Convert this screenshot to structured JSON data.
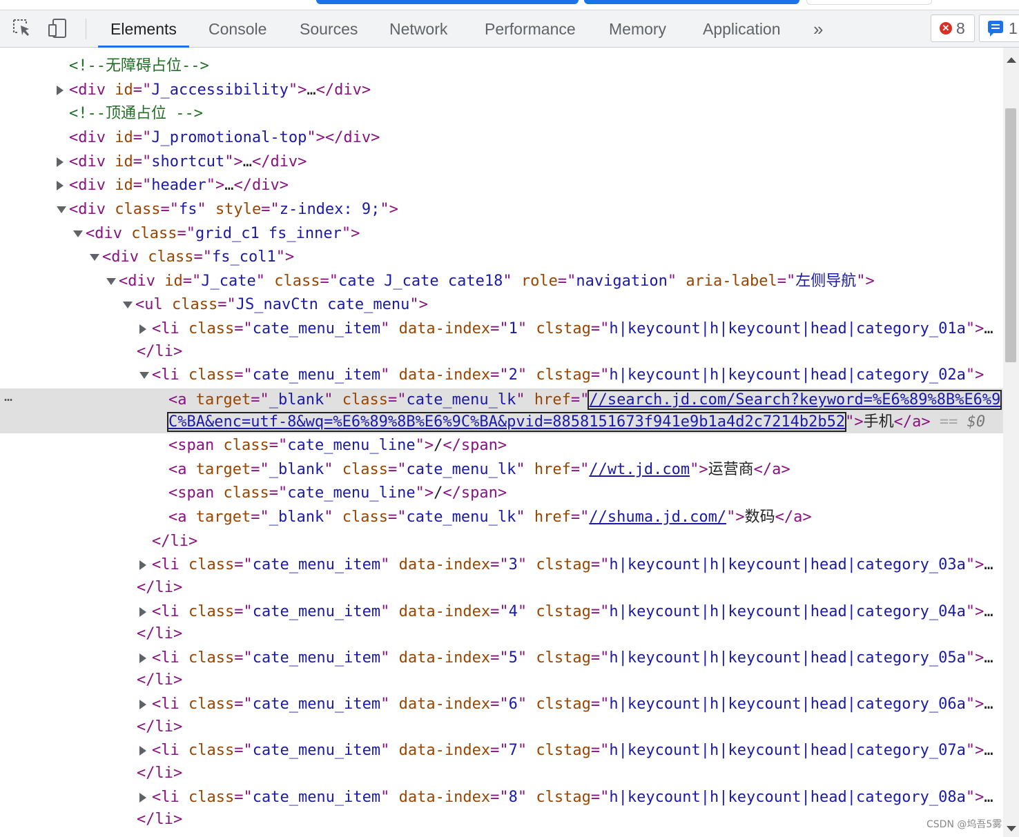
{
  "toolbar": {
    "tabs": [
      "Elements",
      "Console",
      "Sources",
      "Network",
      "Performance",
      "Memory",
      "Application"
    ],
    "more_label": "»",
    "error_count": "8",
    "message_count": "1"
  },
  "lines": [
    {
      "indent": 100,
      "tri": "none",
      "parts": [
        [
          "cm",
          "<!--无障碍占位-->"
        ]
      ]
    },
    {
      "indent": 100,
      "tri": "closed",
      "parts": [
        [
          "t",
          "<div "
        ],
        [
          "an",
          "id"
        ],
        [
          "t",
          "=\""
        ],
        [
          "av",
          "J_accessibility"
        ],
        [
          "t",
          "\">"
        ],
        [
          "tx",
          "…"
        ],
        [
          "t",
          "</div>"
        ]
      ]
    },
    {
      "indent": 100,
      "tri": "none",
      "parts": [
        [
          "cm",
          "<!--顶通占位 -->"
        ]
      ]
    },
    {
      "indent": 100,
      "tri": "none",
      "parts": [
        [
          "t",
          "<div "
        ],
        [
          "an",
          "id"
        ],
        [
          "t",
          "=\""
        ],
        [
          "av",
          "J_promotional-top"
        ],
        [
          "t",
          "\"></div>"
        ]
      ]
    },
    {
      "indent": 100,
      "tri": "closed",
      "parts": [
        [
          "t",
          "<div "
        ],
        [
          "an",
          "id"
        ],
        [
          "t",
          "=\""
        ],
        [
          "av",
          "shortcut"
        ],
        [
          "t",
          "\">"
        ],
        [
          "tx",
          "…"
        ],
        [
          "t",
          "</div>"
        ]
      ]
    },
    {
      "indent": 100,
      "tri": "closed",
      "parts": [
        [
          "t",
          "<div "
        ],
        [
          "an",
          "id"
        ],
        [
          "t",
          "=\""
        ],
        [
          "av",
          "header"
        ],
        [
          "t",
          "\">"
        ],
        [
          "tx",
          "…"
        ],
        [
          "t",
          "</div>"
        ]
      ]
    },
    {
      "indent": 100,
      "tri": "open",
      "parts": [
        [
          "t",
          "<div "
        ],
        [
          "an",
          "class"
        ],
        [
          "t",
          "=\""
        ],
        [
          "av",
          "fs"
        ],
        [
          "t",
          "\" "
        ],
        [
          "an",
          "style"
        ],
        [
          "t",
          "=\""
        ],
        [
          "av",
          "z-index: 9;"
        ],
        [
          "t",
          "\">"
        ]
      ]
    },
    {
      "indent": 124,
      "tri": "open",
      "parts": [
        [
          "t",
          "<div "
        ],
        [
          "an",
          "class"
        ],
        [
          "t",
          "=\""
        ],
        [
          "av",
          "grid_c1 fs_inner"
        ],
        [
          "t",
          "\">"
        ]
      ]
    },
    {
      "indent": 148,
      "tri": "open",
      "parts": [
        [
          "t",
          "<div "
        ],
        [
          "an",
          "class"
        ],
        [
          "t",
          "=\""
        ],
        [
          "av",
          "fs_col1"
        ],
        [
          "t",
          "\">"
        ]
      ]
    },
    {
      "indent": 172,
      "tri": "open",
      "parts": [
        [
          "t",
          "<div "
        ],
        [
          "an",
          "id"
        ],
        [
          "t",
          "=\""
        ],
        [
          "av",
          "J_cate"
        ],
        [
          "t",
          "\" "
        ],
        [
          "an",
          "class"
        ],
        [
          "t",
          "=\""
        ],
        [
          "av",
          "cate J_cate cate18"
        ],
        [
          "t",
          "\" "
        ],
        [
          "an",
          "role"
        ],
        [
          "t",
          "=\""
        ],
        [
          "av",
          "navigation"
        ],
        [
          "t",
          "\" "
        ],
        [
          "an",
          "aria-label"
        ],
        [
          "t",
          "=\""
        ],
        [
          "av",
          "左侧导航"
        ],
        [
          "t",
          "\">"
        ]
      ]
    },
    {
      "indent": 196,
      "tri": "open",
      "parts": [
        [
          "t",
          "<ul "
        ],
        [
          "an",
          "class"
        ],
        [
          "t",
          "=\""
        ],
        [
          "av",
          "JS_navCtn cate_menu"
        ],
        [
          "t",
          "\">"
        ]
      ]
    },
    {
      "indent": 220,
      "tri": "closed",
      "parts": [
        [
          "t",
          "<li "
        ],
        [
          "an",
          "class"
        ],
        [
          "t",
          "=\""
        ],
        [
          "av",
          "cate_menu_item"
        ],
        [
          "t",
          "\" "
        ],
        [
          "an",
          "data-index"
        ],
        [
          "t",
          "=\""
        ],
        [
          "av",
          "1"
        ],
        [
          "t",
          "\" "
        ],
        [
          "an",
          "clstag"
        ],
        [
          "t",
          "=\""
        ],
        [
          "av",
          "h|keycount|h|keycount|head|category_01a"
        ],
        [
          "t",
          "\">"
        ],
        [
          "tx",
          "…"
        ]
      ]
    },
    {
      "indent": 198,
      "tri": "none",
      "parts": [
        [
          "t",
          "</li>"
        ]
      ]
    },
    {
      "indent": 220,
      "tri": "open",
      "parts": [
        [
          "t",
          "<li "
        ],
        [
          "an",
          "class"
        ],
        [
          "t",
          "=\""
        ],
        [
          "av",
          "cate_menu_item"
        ],
        [
          "t",
          "\" "
        ],
        [
          "an",
          "data-index"
        ],
        [
          "t",
          "=\""
        ],
        [
          "av",
          "2"
        ],
        [
          "t",
          "\" "
        ],
        [
          "an",
          "clstag"
        ],
        [
          "t",
          "=\""
        ],
        [
          "av",
          "h|keycount|h|keycount|head|category_02a"
        ],
        [
          "t",
          "\">"
        ]
      ]
    },
    {
      "indent": 244,
      "tri": "none",
      "parts": [
        [
          "t",
          "<a "
        ],
        [
          "an",
          "target"
        ],
        [
          "t",
          "=\""
        ],
        [
          "av",
          "_blank"
        ],
        [
          "t",
          "\" "
        ],
        [
          "an",
          "class"
        ],
        [
          "t",
          "=\""
        ],
        [
          "av",
          "cate_menu_lk"
        ],
        [
          "t",
          "\" "
        ],
        [
          "an",
          "href"
        ],
        [
          "t",
          "=\""
        ],
        [
          "lnkfocus",
          "//search.jd.com/Search?keyword=%E6%89%8B%E6%9"
        ]
      ]
    },
    {
      "indent": 244,
      "tri": "none",
      "parts": [
        [
          "lnkfocus",
          "C%BA&enc=utf-8&wq=%E6%89%8B%E6%9C%BA&pvid=8858151673f941e9b1a4d2c7214b2b52"
        ],
        [
          "t",
          "\">"
        ],
        [
          "tx",
          "手机"
        ],
        [
          "t",
          "</a>"
        ],
        [
          "p",
          " == "
        ],
        [
          "dollar",
          "$0"
        ]
      ]
    },
    {
      "indent": 244,
      "tri": "none",
      "parts": [
        [
          "t",
          "<span "
        ],
        [
          "an",
          "class"
        ],
        [
          "t",
          "=\""
        ],
        [
          "av",
          "cate_menu_line"
        ],
        [
          "t",
          "\">"
        ],
        [
          "tx",
          "/"
        ],
        [
          "t",
          "</span>"
        ]
      ]
    },
    {
      "indent": 244,
      "tri": "none",
      "parts": [
        [
          "t",
          "<a "
        ],
        [
          "an",
          "target"
        ],
        [
          "t",
          "=\""
        ],
        [
          "av",
          "_blank"
        ],
        [
          "t",
          "\" "
        ],
        [
          "an",
          "class"
        ],
        [
          "t",
          "=\""
        ],
        [
          "av",
          "cate_menu_lk"
        ],
        [
          "t",
          "\" "
        ],
        [
          "an",
          "href"
        ],
        [
          "t",
          "=\""
        ],
        [
          "lnk",
          "//wt.jd.com"
        ],
        [
          "t",
          "\">"
        ],
        [
          "tx",
          "运营商"
        ],
        [
          "t",
          "</a>"
        ]
      ]
    },
    {
      "indent": 244,
      "tri": "none",
      "parts": [
        [
          "t",
          "<span "
        ],
        [
          "an",
          "class"
        ],
        [
          "t",
          "=\""
        ],
        [
          "av",
          "cate_menu_line"
        ],
        [
          "t",
          "\">"
        ],
        [
          "tx",
          "/"
        ],
        [
          "t",
          "</span>"
        ]
      ]
    },
    {
      "indent": 244,
      "tri": "none",
      "parts": [
        [
          "t",
          "<a "
        ],
        [
          "an",
          "target"
        ],
        [
          "t",
          "=\""
        ],
        [
          "av",
          "_blank"
        ],
        [
          "t",
          "\" "
        ],
        [
          "an",
          "class"
        ],
        [
          "t",
          "=\""
        ],
        [
          "av",
          "cate_menu_lk"
        ],
        [
          "t",
          "\" "
        ],
        [
          "an",
          "href"
        ],
        [
          "t",
          "=\""
        ],
        [
          "lnk",
          "//shuma.jd.com/"
        ],
        [
          "t",
          "\">"
        ],
        [
          "tx",
          "数码"
        ],
        [
          "t",
          "</a>"
        ]
      ]
    },
    {
      "indent": 220,
      "tri": "none",
      "parts": [
        [
          "t",
          "</li>"
        ]
      ]
    },
    {
      "indent": 220,
      "tri": "closed",
      "parts": [
        [
          "t",
          "<li "
        ],
        [
          "an",
          "class"
        ],
        [
          "t",
          "=\""
        ],
        [
          "av",
          "cate_menu_item"
        ],
        [
          "t",
          "\" "
        ],
        [
          "an",
          "data-index"
        ],
        [
          "t",
          "=\""
        ],
        [
          "av",
          "3"
        ],
        [
          "t",
          "\" "
        ],
        [
          "an",
          "clstag"
        ],
        [
          "t",
          "=\""
        ],
        [
          "av",
          "h|keycount|h|keycount|head|category_03a"
        ],
        [
          "t",
          "\">"
        ],
        [
          "tx",
          "…"
        ]
      ]
    },
    {
      "indent": 198,
      "tri": "none",
      "parts": [
        [
          "t",
          "</li>"
        ]
      ]
    },
    {
      "indent": 220,
      "tri": "closed",
      "parts": [
        [
          "t",
          "<li "
        ],
        [
          "an",
          "class"
        ],
        [
          "t",
          "=\""
        ],
        [
          "av",
          "cate_menu_item"
        ],
        [
          "t",
          "\" "
        ],
        [
          "an",
          "data-index"
        ],
        [
          "t",
          "=\""
        ],
        [
          "av",
          "4"
        ],
        [
          "t",
          "\" "
        ],
        [
          "an",
          "clstag"
        ],
        [
          "t",
          "=\""
        ],
        [
          "av",
          "h|keycount|h|keycount|head|category_04a"
        ],
        [
          "t",
          "\">"
        ],
        [
          "tx",
          "…"
        ]
      ]
    },
    {
      "indent": 198,
      "tri": "none",
      "parts": [
        [
          "t",
          "</li>"
        ]
      ]
    },
    {
      "indent": 220,
      "tri": "closed",
      "parts": [
        [
          "t",
          "<li "
        ],
        [
          "an",
          "class"
        ],
        [
          "t",
          "=\""
        ],
        [
          "av",
          "cate_menu_item"
        ],
        [
          "t",
          "\" "
        ],
        [
          "an",
          "data-index"
        ],
        [
          "t",
          "=\""
        ],
        [
          "av",
          "5"
        ],
        [
          "t",
          "\" "
        ],
        [
          "an",
          "clstag"
        ],
        [
          "t",
          "=\""
        ],
        [
          "av",
          "h|keycount|h|keycount|head|category_05a"
        ],
        [
          "t",
          "\">"
        ],
        [
          "tx",
          "…"
        ]
      ]
    },
    {
      "indent": 198,
      "tri": "none",
      "parts": [
        [
          "t",
          "</li>"
        ]
      ]
    },
    {
      "indent": 220,
      "tri": "closed",
      "parts": [
        [
          "t",
          "<li "
        ],
        [
          "an",
          "class"
        ],
        [
          "t",
          "=\""
        ],
        [
          "av",
          "cate_menu_item"
        ],
        [
          "t",
          "\" "
        ],
        [
          "an",
          "data-index"
        ],
        [
          "t",
          "=\""
        ],
        [
          "av",
          "6"
        ],
        [
          "t",
          "\" "
        ],
        [
          "an",
          "clstag"
        ],
        [
          "t",
          "=\""
        ],
        [
          "av",
          "h|keycount|h|keycount|head|category_06a"
        ],
        [
          "t",
          "\">"
        ],
        [
          "tx",
          "…"
        ]
      ]
    },
    {
      "indent": 198,
      "tri": "none",
      "parts": [
        [
          "t",
          "</li>"
        ]
      ]
    },
    {
      "indent": 220,
      "tri": "closed",
      "parts": [
        [
          "t",
          "<li "
        ],
        [
          "an",
          "class"
        ],
        [
          "t",
          "=\""
        ],
        [
          "av",
          "cate_menu_item"
        ],
        [
          "t",
          "\" "
        ],
        [
          "an",
          "data-index"
        ],
        [
          "t",
          "=\""
        ],
        [
          "av",
          "7"
        ],
        [
          "t",
          "\" "
        ],
        [
          "an",
          "clstag"
        ],
        [
          "t",
          "=\""
        ],
        [
          "av",
          "h|keycount|h|keycount|head|category_07a"
        ],
        [
          "t",
          "\">"
        ],
        [
          "tx",
          "…"
        ]
      ]
    },
    {
      "indent": 198,
      "tri": "none",
      "parts": [
        [
          "t",
          "</li>"
        ]
      ]
    },
    {
      "indent": 220,
      "tri": "closed",
      "parts": [
        [
          "t",
          "<li "
        ],
        [
          "an",
          "class"
        ],
        [
          "t",
          "=\""
        ],
        [
          "av",
          "cate_menu_item"
        ],
        [
          "t",
          "\" "
        ],
        [
          "an",
          "data-index"
        ],
        [
          "t",
          "=\""
        ],
        [
          "av",
          "8"
        ],
        [
          "t",
          "\" "
        ],
        [
          "an",
          "clstag"
        ],
        [
          "t",
          "=\""
        ],
        [
          "av",
          "h|keycount|h|keycount|head|category_08a"
        ],
        [
          "t",
          "\">"
        ],
        [
          "tx",
          "…"
        ]
      ]
    },
    {
      "indent": 198,
      "tri": "none",
      "parts": [
        [
          "t",
          "</li>"
        ]
      ]
    }
  ],
  "selected_dots": "…",
  "watermark": "CSDN @坞吾5雾"
}
